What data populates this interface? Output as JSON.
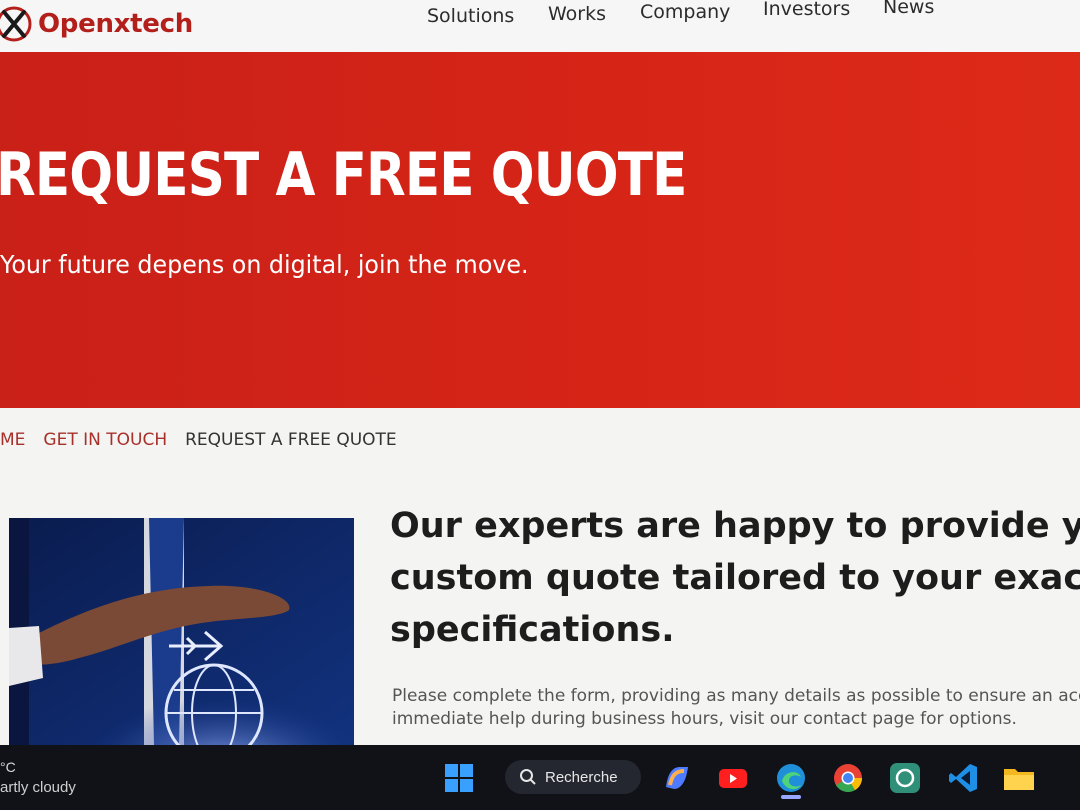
{
  "brand": {
    "name": "Openxtech",
    "accent_color": "#c92018"
  },
  "nav": {
    "items": [
      "Solutions",
      "Works",
      "Company",
      "Investors",
      "News"
    ]
  },
  "hero": {
    "title": "REQUEST A FREE QUOTE",
    "subtitle": "Your future depens on digital, join the move."
  },
  "breadcrumb": {
    "items": [
      "ME",
      "GET IN TOUCH",
      "REQUEST A FREE QUOTE"
    ]
  },
  "intro": {
    "headline_lines": [
      "Our experts are happy to provide you w",
      "custom quote tailored to your exact",
      "specifications."
    ],
    "paragraph_lines": [
      "Please complete the form, providing as many details as possible to ensure an accura",
      "immediate help during business hours, visit our contact page for options."
    ]
  },
  "taskbar": {
    "weather_temp": "°C",
    "weather_desc": "artly cloudy",
    "search_label": "Recherche",
    "icons": [
      "windows-start-icon",
      "search-icon",
      "copilot-icon",
      "youtube-icon",
      "edge-icon",
      "chrome-icon",
      "chatgpt-icon",
      "vscode-icon",
      "file-explorer-icon"
    ]
  }
}
